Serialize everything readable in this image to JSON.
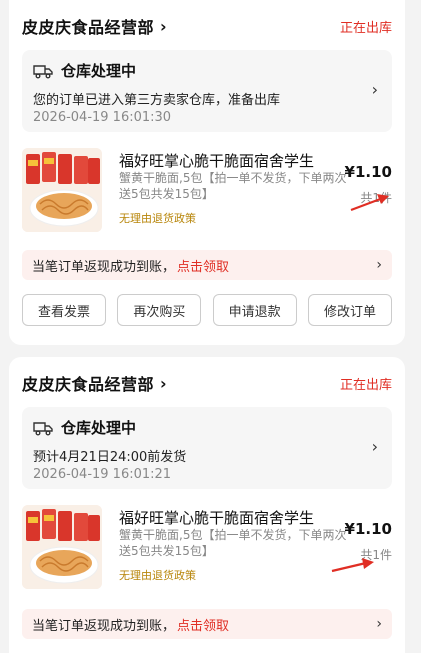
{
  "orders": [
    {
      "store_name": "皮皮庆食品经营部",
      "status": "正在出库",
      "warehouse_title": "仓库处理中",
      "warehouse_desc": "您的订单已进入第三方卖家仓库，准备出库",
      "warehouse_time": "2026-04-19 16:01:30",
      "product_title": "福好旺掌心脆干脆面宿舍学生",
      "product_spec": "蟹黄干脆面,5包【拍一单不发货，下单两次送5包共发15包】",
      "policy": "无理由退货政策",
      "price": "¥1.10",
      "qty": "共1件",
      "rebate_text": "当笔订单返现成功到账，",
      "rebate_link": "点击领取",
      "buttons": [
        "查看发票",
        "再次购买",
        "申请退款",
        "修改订单"
      ]
    },
    {
      "store_name": "皮皮庆食品经营部",
      "status": "正在出库",
      "warehouse_title": "仓库处理中",
      "warehouse_desc": "预计4月21日24:00前发货",
      "warehouse_time": "2026-04-19 16:01:21",
      "product_title": "福好旺掌心脆干脆面宿舍学生",
      "product_spec": "蟹黄干脆面,5包【拍一单不发货，下单两次送5包共发15包】",
      "policy": "无理由退货政策",
      "price": "¥1.10",
      "qty": "共1件",
      "rebate_text": "当笔订单返现成功到账，",
      "rebate_link": "点击领取"
    }
  ],
  "colors": {
    "accent_red": "#e02e24",
    "policy_gold": "#b8860b",
    "page_bg": "#f3f3f3"
  },
  "icons": {
    "warehouse": "truck-icon",
    "chevron": "chevron-right-icon",
    "annotation": "red-arrow-annotation"
  }
}
